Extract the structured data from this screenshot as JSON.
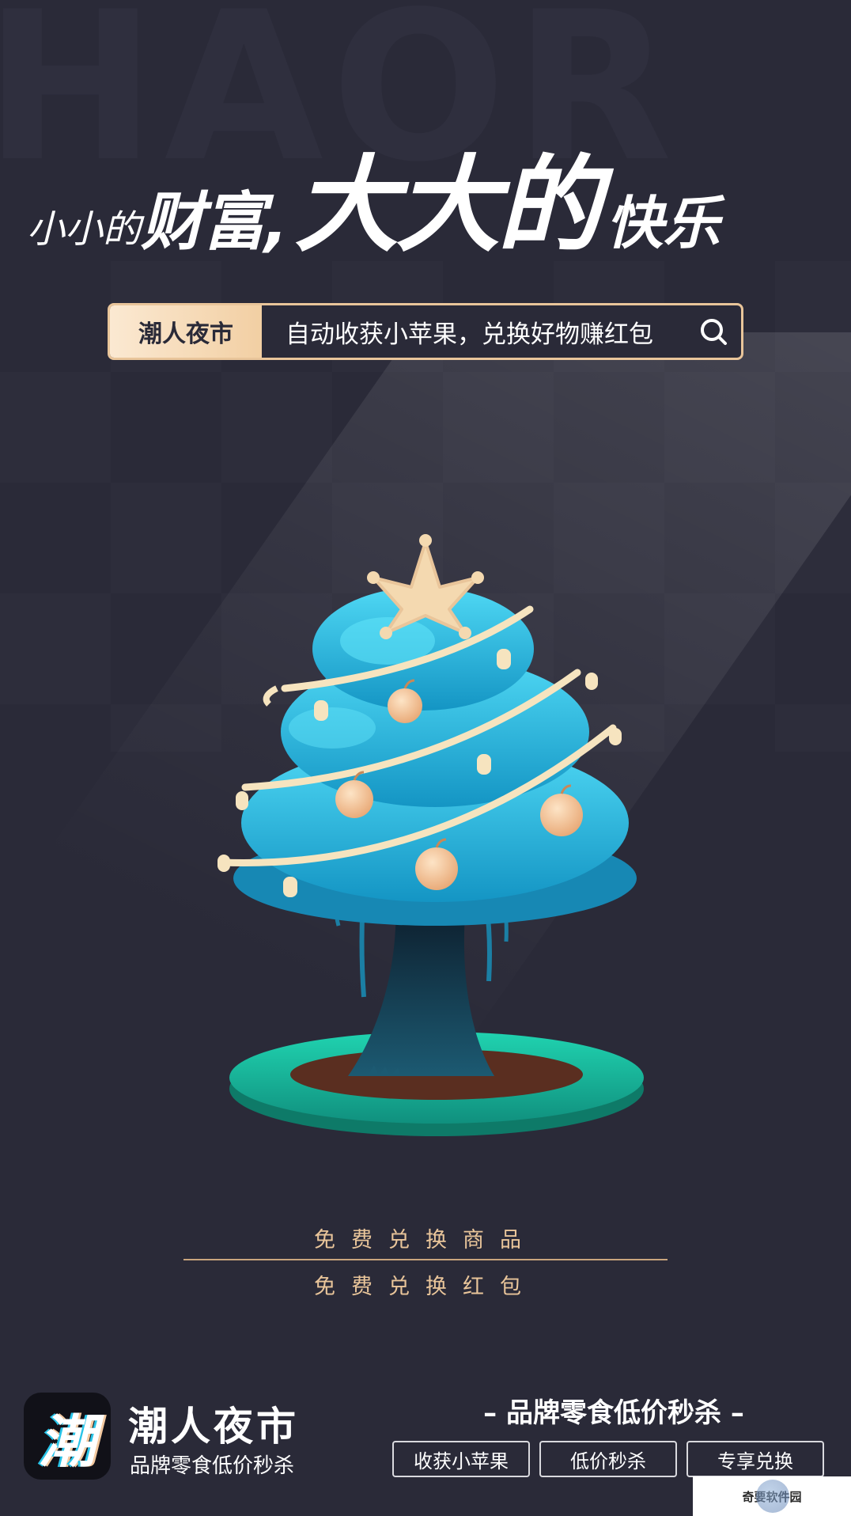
{
  "background": {
    "watermark": "HAOR",
    "color": "#2a2a38"
  },
  "headline": {
    "part1": "小小的",
    "part2": "财富,",
    "part3": "大大的",
    "part4": "快乐"
  },
  "search": {
    "tag": "潮人夜市",
    "text": "自动收获小苹果，兑换好物赚红包",
    "icon": "search-icon",
    "accent": "#e9c59a"
  },
  "tree": {
    "icon": "money-tree-illustration",
    "foliage": "#2ec5e8",
    "ground": "#16c0a0",
    "fruit": "#f3c9a0"
  },
  "mid": {
    "line1": "免费兑换商品",
    "line2": "免费兑换红包"
  },
  "footer": {
    "logo_char": "潮",
    "app_name": "潮人夜市",
    "slogan": "品牌零食低价秒杀",
    "heading": "– 品牌零食低价秒杀 –",
    "buttons": [
      "收获小苹果",
      "低价秒杀",
      "专享兑换"
    ]
  },
  "watermark_badge": {
    "text": "奇要软件园"
  }
}
